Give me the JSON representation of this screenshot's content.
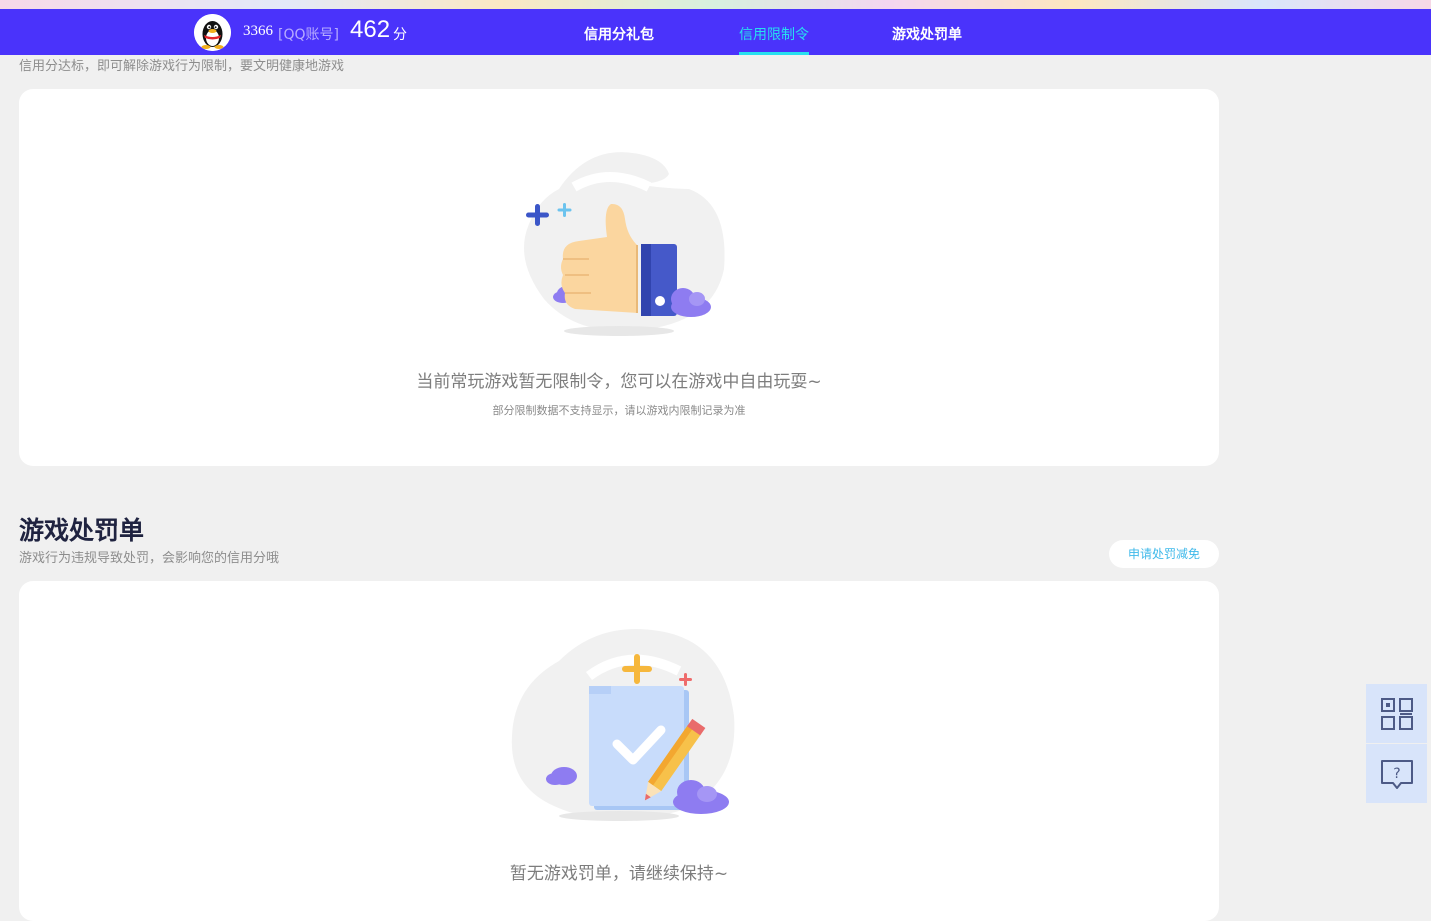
{
  "header": {
    "account_number": "3366",
    "account_tag": "[QQ账号]",
    "score": "462",
    "score_unit": "分",
    "tabs": [
      {
        "label": "信用分礼包",
        "active": false
      },
      {
        "label": "信用限制令",
        "active": true
      },
      {
        "label": "游戏处罚单",
        "active": false
      }
    ],
    "accent_color": "#4a33fb",
    "active_tab_color": "#27e0ef"
  },
  "restriction": {
    "description": "信用分达标，即可解除游戏行为限制，要文明健康地游戏",
    "empty_title": "当前常玩游戏暂无限制令，您可以在游戏中自由玩耍~",
    "empty_note": "部分限制数据不支持显示，请以游戏内限制记录为准",
    "illustration_icon": "thumbs-up-icon"
  },
  "penalty": {
    "title": "游戏处罚单",
    "description": "游戏行为违规导致处罚，会影响您的信用分哦",
    "apply_button": "申请处罚减免",
    "empty_title": "暂无游戏罚单，请继续保持~",
    "illustration_icon": "checklist-pencil-icon"
  },
  "side_tools": [
    {
      "icon": "qr-code-icon"
    },
    {
      "icon": "help-feedback-icon"
    }
  ]
}
